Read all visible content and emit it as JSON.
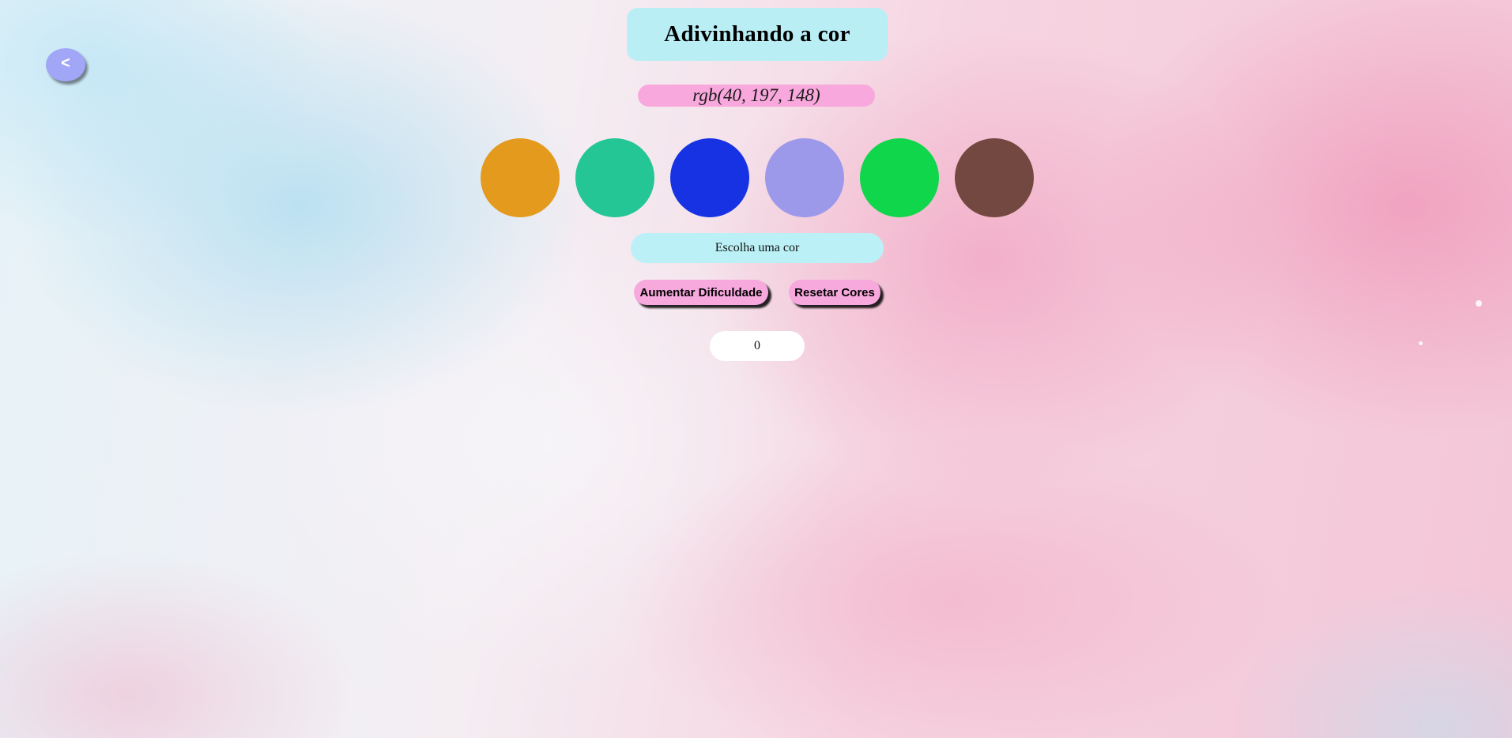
{
  "header": {
    "back_label": "<",
    "title": "Adivinhando a cor"
  },
  "target": {
    "rgb_text": "rgb(40, 197, 148)"
  },
  "palette": {
    "swatches": [
      {
        "color": "#e39a1d"
      },
      {
        "color": "#25c695"
      },
      {
        "color": "#1632e3"
      },
      {
        "color": "#9c98ea"
      },
      {
        "color": "#0fd64a"
      },
      {
        "color": "#734840"
      }
    ]
  },
  "status": {
    "message": "Escolha uma cor"
  },
  "controls": {
    "increase_label": "Aumentar Dificuldade",
    "reset_label": "Resetar Cores"
  },
  "score": {
    "value": "0"
  },
  "colors": {
    "title_bg": "#b9eef5",
    "target_bg": "#f8a8dc",
    "message_bg": "#bbf1f6",
    "button_bg": "#f7a8dc",
    "back_button_bg": "#a2a6f7"
  }
}
